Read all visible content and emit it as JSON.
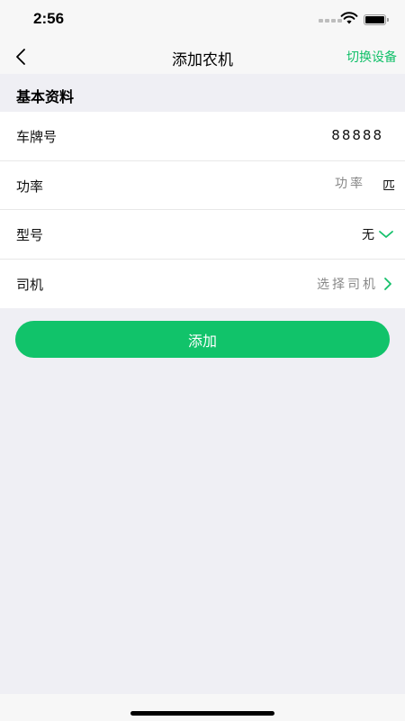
{
  "status_bar": {
    "time": "2:56"
  },
  "nav": {
    "title": "添加农机",
    "switch_device_label": "切换设备"
  },
  "section": {
    "title": "基本资料"
  },
  "form": {
    "plate": {
      "label": "车牌号",
      "value": "88888"
    },
    "power": {
      "label": "功率",
      "placeholder": "功率",
      "unit": "匹"
    },
    "model": {
      "label": "型号",
      "value": "无"
    },
    "driver": {
      "label": "司机",
      "placeholder": "选择司机"
    }
  },
  "actions": {
    "add_label": "添加"
  },
  "colors": {
    "accent": "#13c06a",
    "button": "#11c36a",
    "background": "#efeff4"
  }
}
